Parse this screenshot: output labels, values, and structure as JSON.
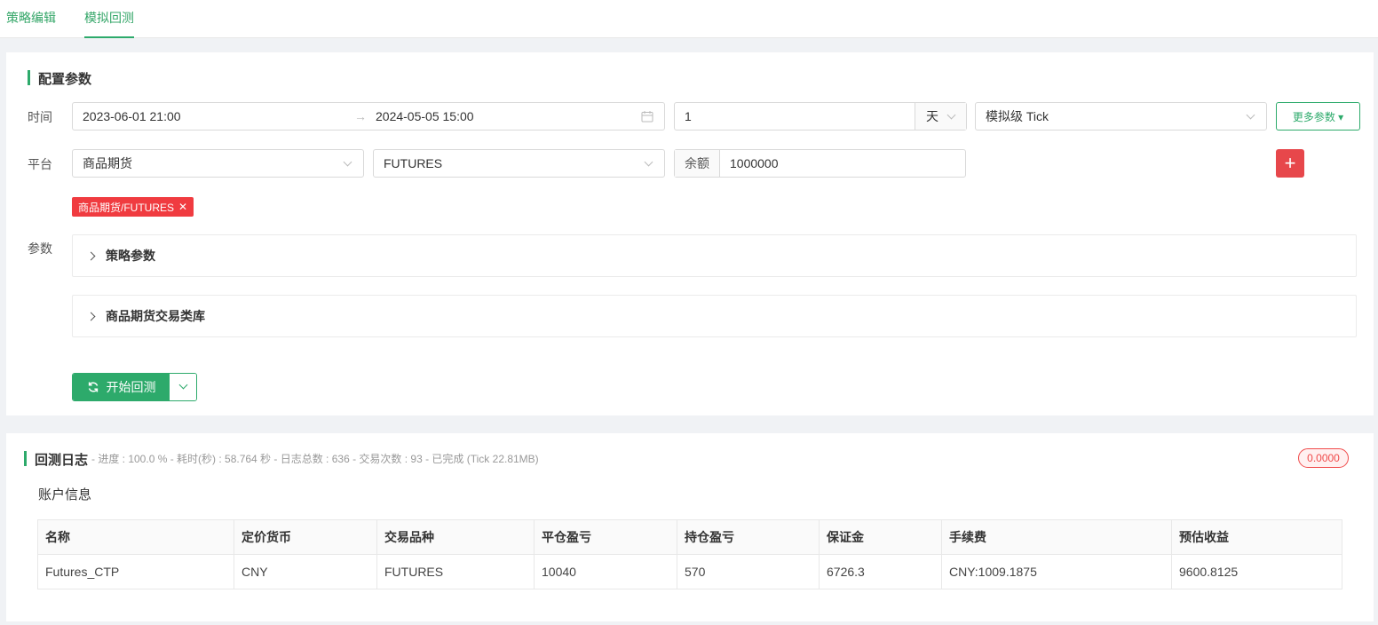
{
  "tabs": [
    "策略编辑",
    "模拟回测"
  ],
  "config": {
    "title": "配置参数",
    "time_label": "时间",
    "start_date": "2023-06-01 21:00",
    "arrow": "→",
    "end_date": "2024-05-05 15:00",
    "period_value": "1",
    "period_unit": "天",
    "mode": "模拟级 Tick",
    "more_params": "更多参数 ▾",
    "platform_label": "平台",
    "exchange": "商品期货",
    "platform": "FUTURES",
    "balance_label": "余额",
    "balance_value": "1000000",
    "add_icon": "+",
    "tag_label": "商品期货/FUTURES",
    "tag_close": "✕",
    "params_label": "参数",
    "strategy_params": "策略参数",
    "futures_lib": "商品期货交易类库",
    "start_button": "开始回测"
  },
  "log": {
    "title": "回测日志",
    "meta": "- 进度 : 100.0 % - 耗时(秒) : 58.764 秒 - 日志总数 : 636 - 交易次数 : 93 - 已完成 (Tick 22.81MB)",
    "badge": "0.0000",
    "account_title": "账户信息",
    "columns": [
      "名称",
      "定价货币",
      "交易品种",
      "平仓盈亏",
      "持仓盈亏",
      "保证金",
      "手续费",
      "预估收益"
    ],
    "rows": [
      [
        "Futures_CTP",
        "CNY",
        "FUTURES",
        "10040",
        "570",
        "6726.3",
        "CNY:1009.1875",
        "9600.8125"
      ]
    ]
  },
  "colors": {
    "accent": "#2daa6b",
    "danger": "#e7474b"
  }
}
